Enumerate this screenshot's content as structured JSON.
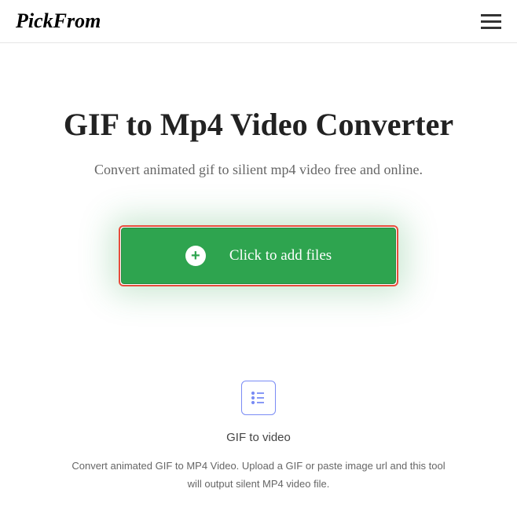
{
  "header": {
    "logo": "PickFrom"
  },
  "main": {
    "title": "GIF to Mp4 Video Converter",
    "subtitle": "Convert animated gif to silient mp4 video free and online.",
    "upload_button_label": "Click to add files"
  },
  "feature": {
    "title": "GIF to video",
    "description": "Convert animated GIF to MP4 Video. Upload a GIF or paste image url and this tool will output silent MP4 video file."
  }
}
